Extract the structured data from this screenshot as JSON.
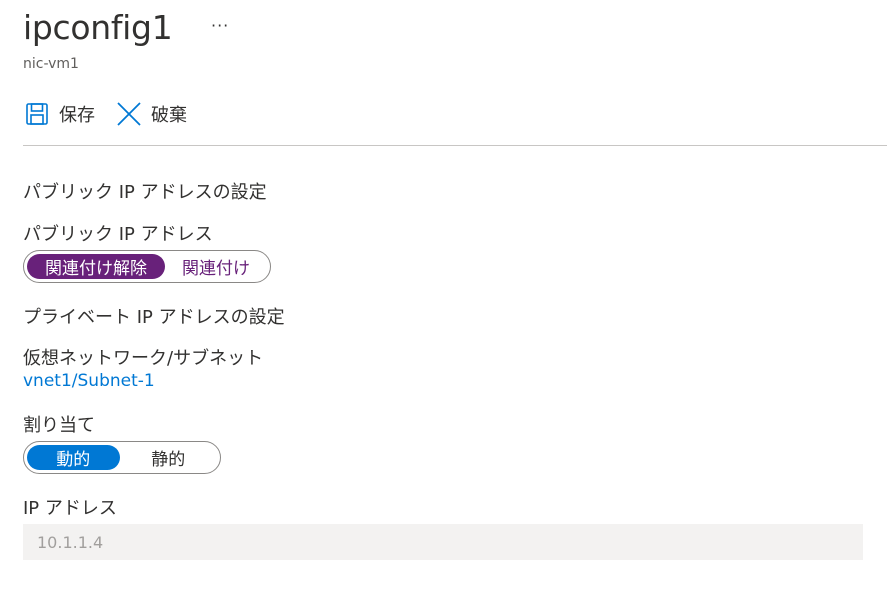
{
  "header": {
    "title": "ipconfig1",
    "subtitle": "nic-vm1",
    "more_label": "···"
  },
  "toolbar": {
    "save_label": "保存",
    "discard_label": "破棄"
  },
  "public_ip": {
    "section_title": "パブリック IP アドレスの設定",
    "field_label": "パブリック IP アドレス",
    "options": [
      "関連付け解除",
      "関連付け"
    ],
    "selected": "関連付け解除"
  },
  "private_ip": {
    "section_title": "プライベート IP アドレスの設定",
    "vnet_label": "仮想ネットワーク/サブネット",
    "vnet_value": "vnet1/Subnet-1",
    "assignment_label": "割り当て",
    "assignment_options": [
      "動的",
      "静的"
    ],
    "assignment_selected": "動的",
    "ip_label": "IP アドレス",
    "ip_value": "10.1.1.4"
  },
  "colors": {
    "accent_purple": "#68217a",
    "accent_blue": "#0078d4",
    "link": "#0078d4"
  },
  "icons": {
    "save": "save-icon",
    "discard": "close-icon",
    "more": "more-icon"
  }
}
